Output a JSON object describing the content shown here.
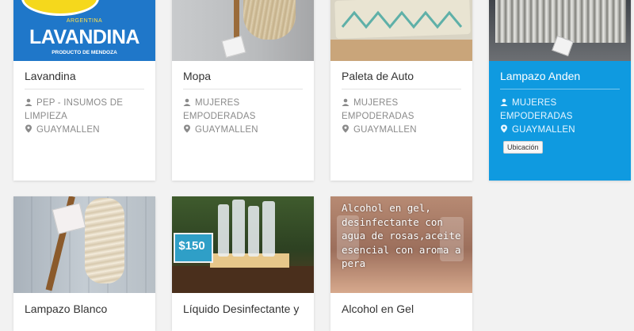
{
  "products": [
    {
      "title": "Lavandina",
      "seller": "PEP - INSUMOS DE LIMPIEZA",
      "location": "GUAYMALLEN",
      "image_label_brand": "ARGENTINA",
      "image_label_main": "LAVANDINA",
      "image_label_sub": "PRODUCTO DE MENDOZA"
    },
    {
      "title": "Mopa",
      "seller": "MUJERES EMPODERADAS",
      "location": "GUAYMALLEN"
    },
    {
      "title": "Paleta de Auto",
      "seller": "MUJERES EMPODERADAS",
      "location": "GUAYMALLEN"
    },
    {
      "title": "Lampazo Anden",
      "seller": "MUJERES EMPODERADAS",
      "location": "GUAYMALLEN",
      "button": "Ubicación"
    },
    {
      "title": "Lampazo Blanco"
    },
    {
      "title": "Líquido Desinfectante y",
      "image_price": "$150"
    },
    {
      "title": "Alcohol en Gel",
      "image_text": "Alcohol en gel, desinfectante con agua de rosas,aceite esencial con aroma a pera"
    }
  ],
  "colors": {
    "selected": "#0f9ae0",
    "background": "#f2f2f2"
  },
  "icons": {
    "seller": "user-icon",
    "location": "map-marker-icon"
  }
}
